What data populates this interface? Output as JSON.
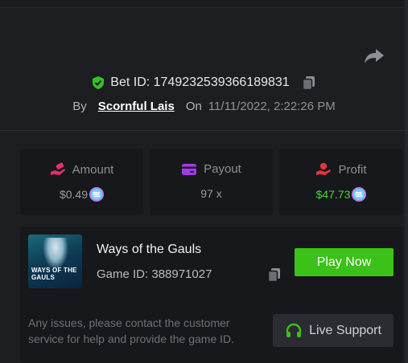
{
  "bet": {
    "id_label": "Bet ID: 1749232539366189831",
    "by_label": "By",
    "username": "Scornful Lais",
    "on_label": "On",
    "datetime": "11/11/2022, 2:22:26 PM"
  },
  "stats": {
    "amount": {
      "label": "Amount",
      "value": "$0.49",
      "icon": "coins-hand-icon"
    },
    "payout": {
      "label": "Payout",
      "value": "97 x",
      "icon": "wallet-card-icon"
    },
    "profit": {
      "label": "Profit",
      "value": "$47.73",
      "icon": "money-hand-icon"
    }
  },
  "game": {
    "title": "Ways of the Gauls",
    "id_label": "Game ID: 388971027",
    "thumb_text": "WAYS OF THE GAULS",
    "play_label": "Play Now",
    "issue_text": "Any issues, please contact the customer service for help and provide the game ID.",
    "support_label": "Live Support"
  },
  "colors": {
    "background": "#1d1e22",
    "card": "#17181c",
    "accent_green": "#3bc117",
    "profit_green": "#48d53b",
    "amount_icon": "#e0306a",
    "payout_icon": "#a33be6",
    "profit_icon": "#e0353f"
  }
}
